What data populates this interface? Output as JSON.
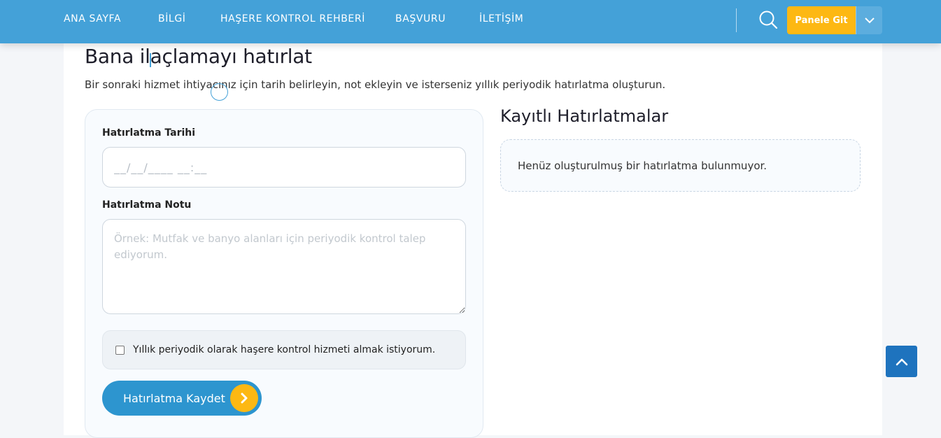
{
  "nav": {
    "items": [
      {
        "label": "ANA SAYFA"
      },
      {
        "label": "BİLGİ"
      },
      {
        "label": "HAŞERE KONTROL REHBERİ"
      },
      {
        "label": "BAŞVURU"
      },
      {
        "label": "İLETİŞİM"
      }
    ],
    "search_icon": "search-icon",
    "panel_button_label": "Panele Git",
    "panel_caret_icon": "chevron-down-icon"
  },
  "page": {
    "title": "Bana ilaçlamayı hatırlat",
    "subtitle": "Bir sonraki hizmet ihtiyacınız için tarih belirleyin, not ekleyin ve isterseniz yıllık periyodik hatırlatma oluşturun."
  },
  "form": {
    "date_label": "Hatırlatma Tarihi",
    "date_placeholder": "__/__/____ __:__",
    "date_value": "",
    "note_label": "Hatırlatma Notu",
    "note_placeholder": "Örnek: Mutfak ve banyo alanları için periyodik kontrol talep ediyorum.",
    "note_value": "",
    "checkbox_label": "Yıllık periyodik olarak haşere kontrol hizmeti almak istiyorum.",
    "checkbox_checked": false,
    "save_label": "Hatırlatma Kaydet",
    "save_icon": "chevron-right-icon"
  },
  "saved": {
    "title": "Kayıtlı Hatırlatmalar",
    "empty_text": "Henüz oluşturulmuş bir hatırlatma bulunmuyor."
  },
  "colors": {
    "header": "#44a1d8",
    "accent": "#fdb813",
    "primary_button": "#2d95cf",
    "scroll_top": "#1e73be"
  },
  "scroll_top_icon": "chevron-up-icon"
}
